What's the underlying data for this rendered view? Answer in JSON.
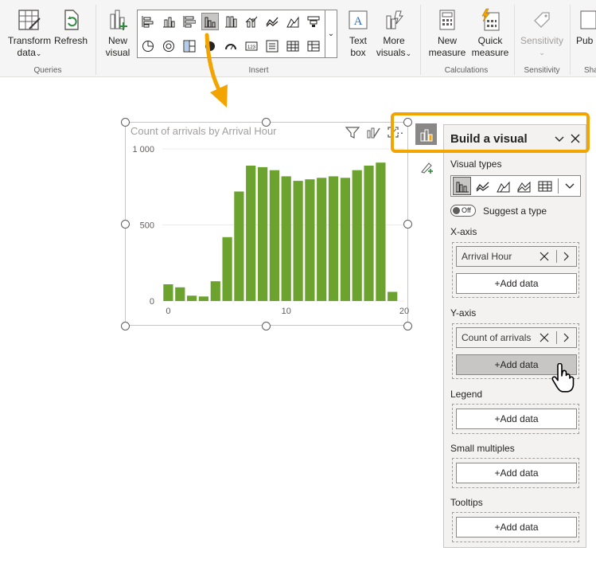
{
  "ribbon": {
    "transform_label_1": "Transform",
    "transform_label_2": "data",
    "refresh_label": "Refresh",
    "queries_group": "Queries",
    "new_visual_1": "New",
    "new_visual_2": "visual",
    "insert_group": "Insert",
    "text_box_1": "Text",
    "text_box_2": "box",
    "more_visuals_1": "More",
    "more_visuals_2": "visuals",
    "new_measure_1": "New",
    "new_measure_2": "measure",
    "quick_measure_1": "Quick",
    "quick_measure_2": "measure",
    "calculations_group": "Calculations",
    "sensitivity_label": "Sensitivity",
    "sensitivity_group": "Sensitivity",
    "publish_label": "Pub",
    "share_group": "Sha"
  },
  "visual": {
    "title": "Count of arrivals by Arrival Hour"
  },
  "chart_data": {
    "type": "bar",
    "title": "Count of arrivals by Arrival Hour",
    "x": [
      0,
      1,
      2,
      3,
      4,
      5,
      6,
      7,
      8,
      9,
      10,
      11,
      12,
      13,
      14,
      15,
      16,
      17,
      18,
      19
    ],
    "values": [
      110,
      90,
      35,
      30,
      130,
      420,
      720,
      890,
      880,
      860,
      820,
      790,
      800,
      810,
      820,
      810,
      860,
      890,
      910,
      60
    ],
    "xticks": [
      "0",
      "10",
      "20"
    ],
    "yticks": [
      "0",
      "500",
      "1 000"
    ],
    "ylim": [
      0,
      1000
    ],
    "xlim": [
      -0.5,
      20
    ],
    "color": "#6ba32e",
    "grid": true
  },
  "pane": {
    "title": "Build a visual",
    "visual_types_label": "Visual types",
    "toggle_text": "Off",
    "suggest_label": "Suggest a type",
    "xaxis_label": "X-axis",
    "xaxis_field": "Arrival Hour",
    "yaxis_label": "Y-axis",
    "yaxis_field": "Count of arrivals",
    "legend_label": "Legend",
    "small_multiples_label": "Small multiples",
    "tooltips_label": "Tooltips",
    "add_data": "+Add data"
  },
  "colors": {
    "accent_highlight": "#f2a400",
    "bar": "#6ba32e",
    "arrow": "#f2a400"
  }
}
